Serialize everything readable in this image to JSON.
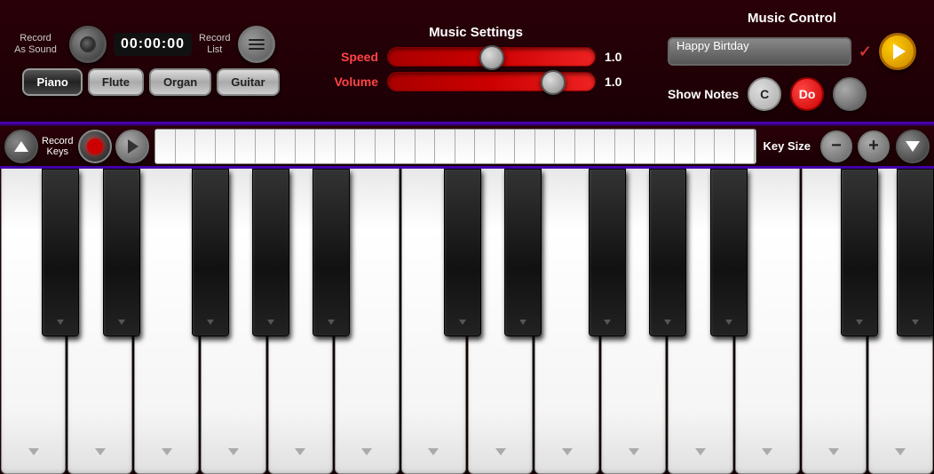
{
  "header": {
    "record_as_sound": "Record\nAs Sound",
    "record_as_sound_line1": "Record",
    "record_as_sound_line2": "As Sound",
    "time_display": "00:00:00",
    "record_list_line1": "Record",
    "record_list_line2": "List"
  },
  "music_settings": {
    "title": "Music Settings",
    "speed_label": "Speed",
    "speed_value": "1.0",
    "volume_label": "Volume",
    "volume_value": "1.0"
  },
  "music_control": {
    "title": "Music Control",
    "song_name": "Happy Birtday",
    "show_notes_label": "Show Notes",
    "note_c": "C",
    "note_do": "Do"
  },
  "instruments": {
    "piano": "Piano",
    "flute": "Flute",
    "organ": "Organ",
    "guitar": "Guitar"
  },
  "strip": {
    "record_keys_label": "Record\nKeys",
    "key_size_label": "Key Size",
    "minus_label": "−",
    "plus_label": "+"
  }
}
